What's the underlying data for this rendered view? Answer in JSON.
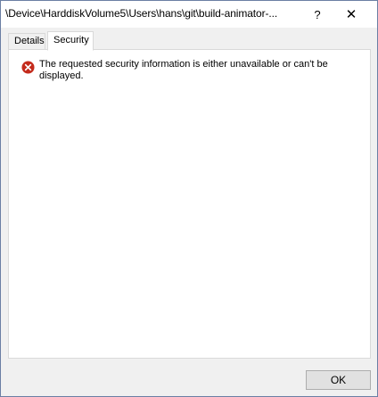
{
  "window": {
    "title": "\\Device\\HarddiskVolume5\\Users\\hans\\git\\build-animator-...",
    "help_label": "?",
    "close_label": "✕"
  },
  "tabs": [
    {
      "label": "Details",
      "selected": false
    },
    {
      "label": "Security",
      "selected": true
    }
  ],
  "security": {
    "icon": "error-icon",
    "message": "The requested security information is either unavailable or can't be displayed."
  },
  "buttons": {
    "ok_label": "OK"
  },
  "colors": {
    "error_red": "#c42b1c",
    "accent_border": "#6b7fa4"
  }
}
